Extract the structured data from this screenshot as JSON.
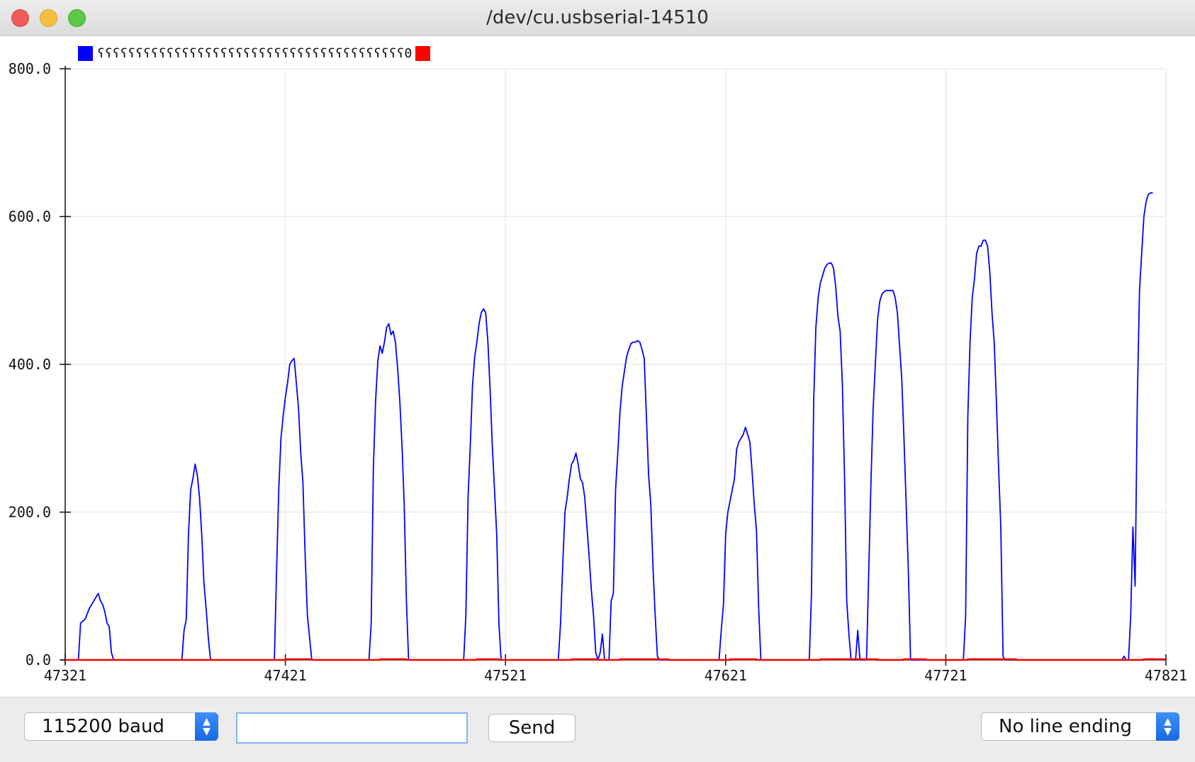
{
  "window": {
    "title": "/dev/cu.usbserial-14510"
  },
  "legend": [
    {
      "name": "ʕʕʕʕʕʕʕʕʕʕʕʕʕʕʕʕʕʕʕʕʕʕʕʕʕʕʕʕʕʕʕʕʕʕʕʕʕʕʕʕ0",
      "color": "#0000ff"
    },
    {
      "name": "",
      "color": "#ff0000"
    }
  ],
  "controls": {
    "baud": "115200 baud",
    "message_placeholder": "",
    "send": "Send",
    "line_ending": "No line ending"
  },
  "chart_data": {
    "type": "line",
    "title": "",
    "xlabel": "",
    "ylabel": "",
    "grid": true,
    "legend_position": "top-left",
    "xlim": [
      47321,
      47821
    ],
    "ylim": [
      0,
      800
    ],
    "x_ticks": [
      "47321",
      "47421",
      "47521",
      "47621",
      "47721",
      "47821"
    ],
    "y_ticks": [
      "0.0",
      "200.0",
      "400.0",
      "600.0",
      "800.0"
    ],
    "series": [
      {
        "color": "#0000ff",
        "points": [
          [
            47321,
            0
          ],
          [
            47327,
            0
          ],
          [
            47328,
            50
          ],
          [
            47330,
            55
          ],
          [
            47332,
            70
          ],
          [
            47333,
            75
          ],
          [
            47334,
            80
          ],
          [
            47335,
            85
          ],
          [
            47336,
            90
          ],
          [
            47337,
            80
          ],
          [
            47338,
            75
          ],
          [
            47339,
            65
          ],
          [
            47340,
            50
          ],
          [
            47341,
            45
          ],
          [
            47342,
            10
          ],
          [
            47343,
            0
          ],
          [
            47374,
            0
          ],
          [
            47375,
            40
          ],
          [
            47376,
            55
          ],
          [
            47377,
            170
          ],
          [
            47378,
            230
          ],
          [
            47379,
            245
          ],
          [
            47380,
            265
          ],
          [
            47381,
            250
          ],
          [
            47382,
            220
          ],
          [
            47383,
            170
          ],
          [
            47384,
            105
          ],
          [
            47385,
            70
          ],
          [
            47386,
            30
          ],
          [
            47387,
            0
          ],
          [
            47416,
            0
          ],
          [
            47417,
            120
          ],
          [
            47418,
            230
          ],
          [
            47419,
            300
          ],
          [
            47420,
            330
          ],
          [
            47421,
            355
          ],
          [
            47422,
            375
          ],
          [
            47423,
            400
          ],
          [
            47424,
            405
          ],
          [
            47425,
            408
          ],
          [
            47426,
            375
          ],
          [
            47427,
            340
          ],
          [
            47428,
            280
          ],
          [
            47429,
            240
          ],
          [
            47430,
            140
          ],
          [
            47431,
            60
          ],
          [
            47432,
            30
          ],
          [
            47433,
            0
          ],
          [
            47459,
            0
          ],
          [
            47460,
            50
          ],
          [
            47461,
            260
          ],
          [
            47462,
            350
          ],
          [
            47463,
            405
          ],
          [
            47464,
            425
          ],
          [
            47465,
            415
          ],
          [
            47466,
            430
          ],
          [
            47467,
            450
          ],
          [
            47468,
            455
          ],
          [
            47469,
            440
          ],
          [
            47470,
            445
          ],
          [
            47471,
            430
          ],
          [
            47472,
            395
          ],
          [
            47473,
            350
          ],
          [
            47474,
            290
          ],
          [
            47475,
            210
          ],
          [
            47476,
            80
          ],
          [
            47477,
            0
          ],
          [
            47502,
            0
          ],
          [
            47503,
            60
          ],
          [
            47504,
            220
          ],
          [
            47505,
            290
          ],
          [
            47506,
            370
          ],
          [
            47507,
            410
          ],
          [
            47508,
            430
          ],
          [
            47509,
            455
          ],
          [
            47510,
            470
          ],
          [
            47511,
            475
          ],
          [
            47512,
            470
          ],
          [
            47513,
            430
          ],
          [
            47514,
            365
          ],
          [
            47515,
            290
          ],
          [
            47516,
            230
          ],
          [
            47517,
            170
          ],
          [
            47518,
            50
          ],
          [
            47519,
            0
          ],
          [
            47545,
            0
          ],
          [
            47546,
            50
          ],
          [
            47547,
            130
          ],
          [
            47548,
            200
          ],
          [
            47549,
            220
          ],
          [
            47550,
            245
          ],
          [
            47551,
            265
          ],
          [
            47552,
            270
          ],
          [
            47553,
            280
          ],
          [
            47554,
            265
          ],
          [
            47555,
            245
          ],
          [
            47556,
            240
          ],
          [
            47557,
            220
          ],
          [
            47558,
            180
          ],
          [
            47559,
            140
          ],
          [
            47560,
            95
          ],
          [
            47561,
            60
          ],
          [
            47562,
            10
          ],
          [
            47563,
            0
          ],
          [
            47564,
            10
          ],
          [
            47565,
            35
          ],
          [
            47566,
            0
          ],
          [
            47568,
            0
          ],
          [
            47569,
            80
          ],
          [
            47570,
            90
          ],
          [
            47571,
            230
          ],
          [
            47572,
            280
          ],
          [
            47573,
            335
          ],
          [
            47574,
            370
          ],
          [
            47575,
            390
          ],
          [
            47576,
            410
          ],
          [
            47577,
            420
          ],
          [
            47578,
            428
          ],
          [
            47579,
            430
          ],
          [
            47580,
            430
          ],
          [
            47581,
            432
          ],
          [
            47582,
            430
          ],
          [
            47583,
            420
          ],
          [
            47584,
            408
          ],
          [
            47585,
            330
          ],
          [
            47586,
            250
          ],
          [
            47587,
            210
          ],
          [
            47588,
            125
          ],
          [
            47589,
            60
          ],
          [
            47590,
            5
          ],
          [
            47591,
            0
          ],
          [
            47618,
            0
          ],
          [
            47619,
            40
          ],
          [
            47620,
            75
          ],
          [
            47621,
            170
          ],
          [
            47622,
            200
          ],
          [
            47623,
            215
          ],
          [
            47624,
            230
          ],
          [
            47625,
            245
          ],
          [
            47626,
            285
          ],
          [
            47627,
            295
          ],
          [
            47628,
            300
          ],
          [
            47629,
            305
          ],
          [
            47630,
            315
          ],
          [
            47631,
            305
          ],
          [
            47632,
            295
          ],
          [
            47633,
            255
          ],
          [
            47634,
            210
          ],
          [
            47635,
            175
          ],
          [
            47636,
            70
          ],
          [
            47637,
            0
          ],
          [
            47659,
            0
          ],
          [
            47660,
            90
          ],
          [
            47661,
            350
          ],
          [
            47662,
            450
          ],
          [
            47663,
            490
          ],
          [
            47664,
            510
          ],
          [
            47665,
            520
          ],
          [
            47666,
            530
          ],
          [
            47667,
            535
          ],
          [
            47668,
            537
          ],
          [
            47669,
            537
          ],
          [
            47670,
            530
          ],
          [
            47671,
            505
          ],
          [
            47672,
            465
          ],
          [
            47673,
            445
          ],
          [
            47674,
            375
          ],
          [
            47675,
            250
          ],
          [
            47676,
            80
          ],
          [
            47677,
            35
          ],
          [
            47678,
            0
          ],
          [
            47680,
            0
          ],
          [
            47681,
            40
          ],
          [
            47682,
            0
          ],
          [
            47685,
            0
          ],
          [
            47686,
            120
          ],
          [
            47687,
            240
          ],
          [
            47688,
            340
          ],
          [
            47689,
            400
          ],
          [
            47690,
            460
          ],
          [
            47691,
            485
          ],
          [
            47692,
            495
          ],
          [
            47693,
            498
          ],
          [
            47694,
            500
          ],
          [
            47695,
            500
          ],
          [
            47696,
            500
          ],
          [
            47697,
            500
          ],
          [
            47698,
            490
          ],
          [
            47699,
            470
          ],
          [
            47700,
            425
          ],
          [
            47701,
            380
          ],
          [
            47702,
            300
          ],
          [
            47703,
            210
          ],
          [
            47704,
            120
          ],
          [
            47705,
            0
          ],
          [
            47729,
            0
          ],
          [
            47730,
            60
          ],
          [
            47731,
            330
          ],
          [
            47732,
            430
          ],
          [
            47733,
            490
          ],
          [
            47734,
            515
          ],
          [
            47735,
            550
          ],
          [
            47736,
            560
          ],
          [
            47737,
            560
          ],
          [
            47738,
            568
          ],
          [
            47739,
            568
          ],
          [
            47740,
            560
          ],
          [
            47741,
            525
          ],
          [
            47742,
            470
          ],
          [
            47743,
            430
          ],
          [
            47744,
            350
          ],
          [
            47745,
            260
          ],
          [
            47746,
            180
          ],
          [
            47747,
            5
          ],
          [
            47748,
            0
          ],
          [
            47801,
            0
          ],
          [
            47802,
            5
          ],
          [
            47803,
            0
          ],
          [
            47804,
            0
          ],
          [
            47805,
            60
          ],
          [
            47806,
            180
          ],
          [
            47807,
            100
          ],
          [
            47808,
            350
          ],
          [
            47809,
            500
          ],
          [
            47810,
            550
          ],
          [
            47811,
            600
          ],
          [
            47812,
            620
          ],
          [
            47813,
            630
          ],
          [
            47814,
            632
          ],
          [
            47815,
            632
          ]
        ]
      },
      {
        "color": "#ff0000",
        "points": [
          [
            47321,
            0
          ],
          [
            47421,
            0
          ],
          [
            47421,
            1
          ],
          [
            47433,
            1
          ],
          [
            47433,
            0
          ],
          [
            47464,
            0
          ],
          [
            47464,
            1
          ],
          [
            47476,
            1
          ],
          [
            47476,
            0
          ],
          [
            47508,
            0
          ],
          [
            47508,
            1
          ],
          [
            47518,
            1
          ],
          [
            47518,
            0
          ],
          [
            47551,
            0
          ],
          [
            47551,
            1
          ],
          [
            47563,
            1
          ],
          [
            47563,
            0
          ],
          [
            47573,
            0
          ],
          [
            47573,
            1
          ],
          [
            47595,
            1
          ],
          [
            47595,
            0
          ],
          [
            47623,
            0
          ],
          [
            47623,
            1
          ],
          [
            47635,
            1
          ],
          [
            47635,
            0
          ],
          [
            47664,
            0
          ],
          [
            47664,
            1
          ],
          [
            47690,
            1
          ],
          [
            47690,
            0
          ],
          [
            47702,
            0
          ],
          [
            47702,
            1
          ],
          [
            47712,
            1
          ],
          [
            47712,
            0
          ],
          [
            47731,
            0
          ],
          [
            47731,
            1
          ],
          [
            47753,
            1
          ],
          [
            47753,
            0
          ],
          [
            47811,
            0
          ],
          [
            47811,
            1
          ],
          [
            47821,
            1
          ]
        ]
      }
    ]
  }
}
